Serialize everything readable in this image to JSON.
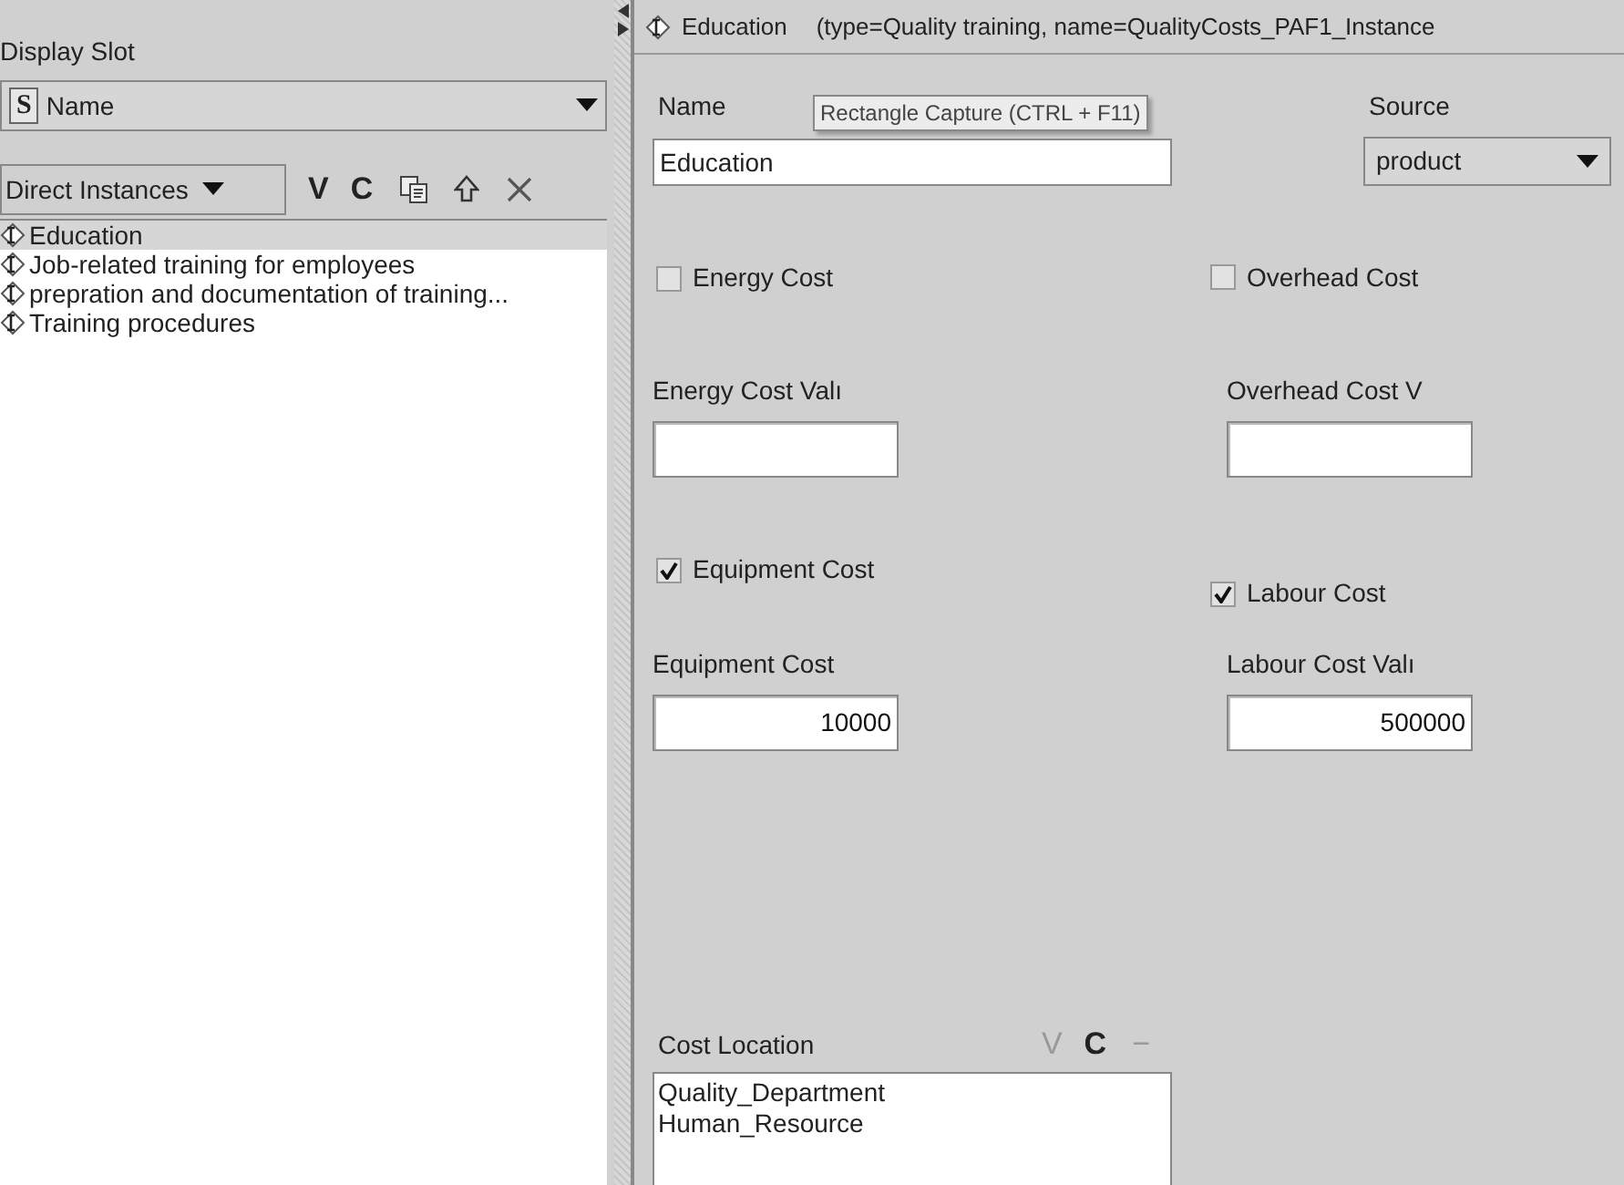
{
  "left_panel": {
    "display_slot_label": "Display Slot",
    "slot_combo": {
      "badge": "S",
      "value": "Name"
    },
    "instances_dropdown": "Direct Instances",
    "toolbar": [
      "V",
      "C"
    ],
    "instances": [
      {
        "label": "Education",
        "selected": true
      },
      {
        "label": "Job-related training for employees",
        "selected": false
      },
      {
        "label": "prepration and documentation of traininɡ...",
        "selected": false
      },
      {
        "label": "Training procedures",
        "selected": false
      }
    ]
  },
  "form": {
    "header_name": "Education",
    "header_detail": "(type=Quality training, name=QualityCosts_PAF1_Instance",
    "tooltip": "Rectangle Capture (CTRL + F11)",
    "name_label": "Name",
    "name_value": "Education",
    "source_label": "Source",
    "source_value": "product",
    "checkboxes": [
      {
        "label": "Energy Cost",
        "checked": false
      },
      {
        "label": "Overhead Cost",
        "checked": false
      },
      {
        "label": "Equipment Cost",
        "checked": true
      },
      {
        "label": "Labour Cost",
        "checked": true
      }
    ],
    "value_fields": [
      {
        "label": "Energy Cost Valı"
      },
      {
        "label": "Overhead Cost V"
      },
      {
        "label": "Equipment Cost",
        "value": "10000"
      },
      {
        "label": "Labour Cost Valı",
        "value": "500000"
      }
    ],
    "cost_location": {
      "label": "Cost Location",
      "toolbar": [
        "V",
        "C",
        "−"
      ],
      "items": [
        "Quality_Department",
        "Human_Resource"
      ]
    }
  }
}
